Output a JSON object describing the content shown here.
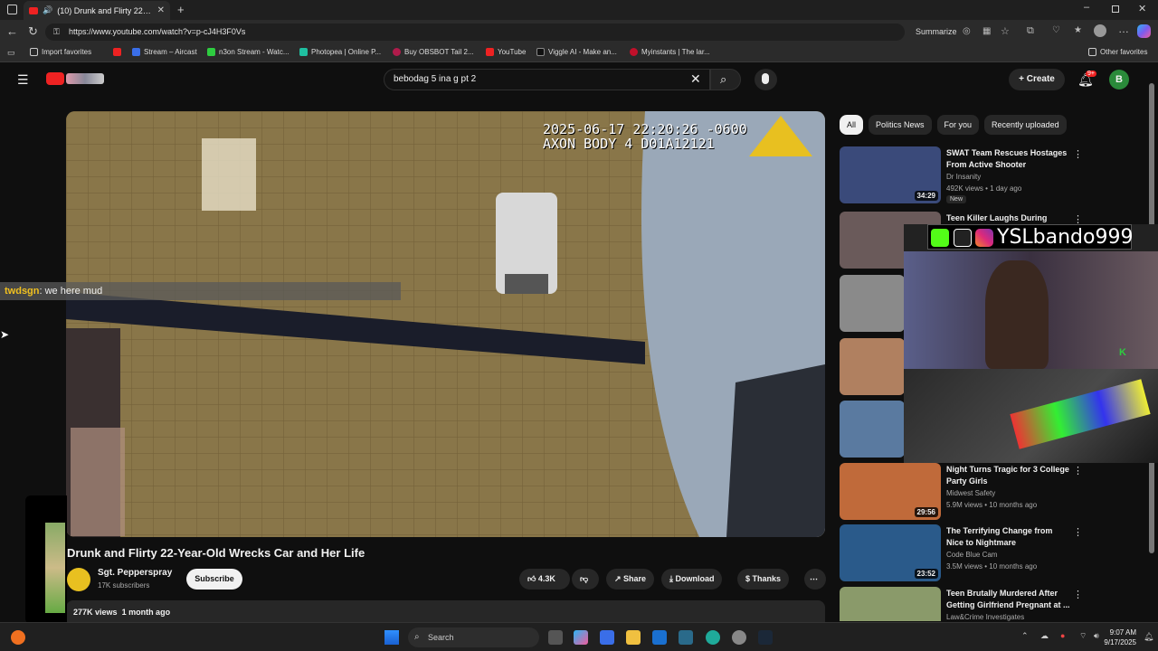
{
  "browser": {
    "tab_title": "(10) Drunk and Flirty 22-Year-",
    "url": "https://www.youtube.com/watch?v=p-cJ4H3F0Vs",
    "summarize_label": "Summarize",
    "bookmarks": [
      {
        "label": "Import favorites",
        "color": "#cfcfcf"
      },
      {
        "label": "",
        "color": "#e22"
      },
      {
        "label": "Stream – Aircast",
        "color": "#3a6ee8"
      },
      {
        "label": "n3on Stream - Watc...",
        "color": "#2ecc40"
      },
      {
        "label": "Photopea | Online P...",
        "color": "#1fbfa0"
      },
      {
        "label": "Buy OBSBOT Tail 2...",
        "color": "#b01b4b"
      },
      {
        "label": "YouTube",
        "color": "#e22"
      },
      {
        "label": "Viggle AI - Make an...",
        "color": "#111"
      },
      {
        "label": "Myinstants | The lar...",
        "color": "#c0102a"
      }
    ],
    "other_favorites": "Other favorites"
  },
  "youtube": {
    "search_value": "bebodag 5 ina g pt 2",
    "create_label": "Create",
    "notification_count": "9+",
    "avatar_letter": "B"
  },
  "video": {
    "timestamp_line1": "2025-06-17 22:20:26 -0600",
    "timestamp_line2": "AXON BODY 4 D01A12121",
    "title": "Drunk and Flirty 22-Year-Old Wrecks Car and Her Life",
    "channel": "Sgt. Pepperspray",
    "subscribers": "17K subscribers",
    "subscribe_label": "Subscribe",
    "likes": "4.3K",
    "share_label": "Share",
    "download_label": "Download",
    "thanks_label": "Thanks",
    "views": "277K views",
    "age": "1 month ago"
  },
  "chat": {
    "user": "twdsgn",
    "message": ": we here mud"
  },
  "chips": [
    "All",
    "Politics News",
    "For you",
    "Recently uploaded"
  ],
  "recommendations": [
    {
      "title": "SWAT Team Rescues Hostages From Active Shooter",
      "channel": "Dr Insanity",
      "views": "492K views",
      "age": "1 day ago",
      "duration": "34:29",
      "badge": "New",
      "thumb": "#3a4a7a"
    },
    {
      "title": "Teen Killer Laughs During",
      "channel": "",
      "views": "",
      "age": "",
      "duration": "",
      "badge": "",
      "thumb": "#6a5a5a"
    },
    {
      "title": "Night Turns Tragic for 3 College Party Girls",
      "channel": "Midwest Safety",
      "views": "5.9M views",
      "age": "10 months ago",
      "duration": "29:56",
      "badge": "",
      "thumb": "#c06a3a"
    },
    {
      "title": "The Terrifying Change from Nice to Nightmare",
      "channel": "Code Blue Cam",
      "views": "3.5M views",
      "age": "10 months ago",
      "duration": "23:52",
      "badge": "",
      "thumb": "#2a5a8a"
    },
    {
      "title": "Teen Brutally Murdered After Getting Girlfriend Pregnant at ...",
      "channel": "Law&Crime Investigates",
      "views": "",
      "age": "",
      "duration": "",
      "badge": "",
      "thumb": "#8a9a6a"
    }
  ],
  "overlay": {
    "name": "YSLbando999"
  },
  "taskbar": {
    "search_placeholder": "Search",
    "time": "9:07 AM",
    "date": "9/17/2025"
  }
}
